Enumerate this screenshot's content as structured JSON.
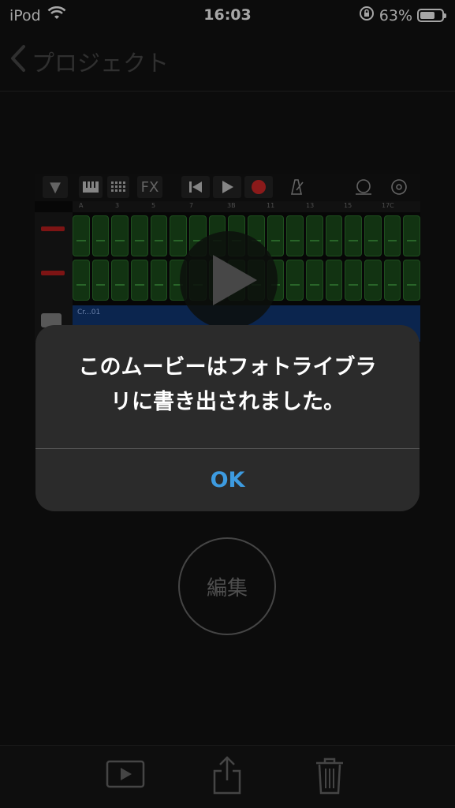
{
  "status": {
    "carrier": "iPod",
    "time": "16:03",
    "battery": "63%"
  },
  "nav": {
    "back_label": "プロジェクト"
  },
  "thumbnail": {
    "toolbar_fx": "FX",
    "ruler_marks": [
      "A",
      "3",
      "5",
      "7",
      "3B",
      "11",
      "13",
      "15",
      "17C"
    ],
    "audio_region_label": "Cr...01"
  },
  "alert": {
    "line1": "このムービーはフォトライブラ",
    "line2": "リに書き出されました。",
    "ok_label": "OK"
  },
  "edit_label": "編集",
  "colors": {
    "accent": "#3d9be0",
    "background": "#131313",
    "alert_bg": "#2b2b2b"
  }
}
